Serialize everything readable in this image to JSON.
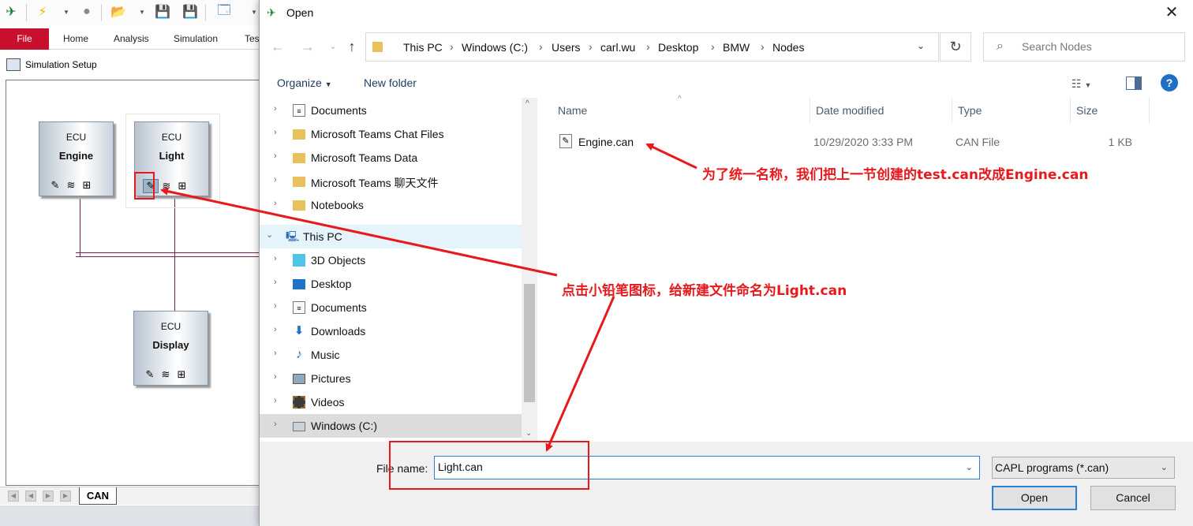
{
  "app": {
    "ribbon_tabs": [
      "File",
      "Home",
      "Analysis",
      "Simulation",
      "Tes"
    ],
    "toolbar_label": "Simulation Setup",
    "ecus": [
      {
        "kind": "ECU",
        "name": "Engine"
      },
      {
        "kind": "ECU",
        "name": "Light"
      },
      {
        "kind": "ECU",
        "name": "Display"
      }
    ],
    "bus_tab": "CAN",
    "accent_color": "#c8102e",
    "wire_color": "#7d1f4e"
  },
  "dialog": {
    "title": "Open",
    "breadcrumbs": [
      "This PC",
      "Windows (C:)",
      "Users",
      "carl.wu",
      "Desktop",
      "BMW",
      "Nodes"
    ],
    "search_placeholder": "Search Nodes",
    "organize_label": "Organize",
    "new_folder_label": "New folder",
    "tree": [
      {
        "label": "Documents",
        "icon": "document-icon"
      },
      {
        "label": "Microsoft Teams Chat Files",
        "icon": "folder-icon"
      },
      {
        "label": "Microsoft Teams Data",
        "icon": "folder-icon"
      },
      {
        "label": "Microsoft Teams 聊天文件",
        "icon": "folder-icon"
      },
      {
        "label": "Notebooks",
        "icon": "folder-icon"
      },
      {
        "label": "This PC",
        "icon": "computer-icon"
      },
      {
        "label": "3D Objects",
        "icon": "cube-icon"
      },
      {
        "label": "Desktop",
        "icon": "desktop-icon"
      },
      {
        "label": "Documents",
        "icon": "document-icon"
      },
      {
        "label": "Downloads",
        "icon": "download-icon"
      },
      {
        "label": "Music",
        "icon": "music-icon"
      },
      {
        "label": "Pictures",
        "icon": "picture-icon"
      },
      {
        "label": "Videos",
        "icon": "video-icon"
      },
      {
        "label": "Windows (C:)",
        "icon": "drive-icon"
      }
    ],
    "columns": [
      "Name",
      "Date modified",
      "Type",
      "Size"
    ],
    "files": [
      {
        "name": "Engine.can",
        "date": "10/29/2020 3:33 PM",
        "type": "CAN File",
        "size": "1 KB"
      }
    ],
    "file_name_label": "File name:",
    "file_name_value": "Light.can",
    "file_type": "CAPL programs (*.can)",
    "open_label": "Open",
    "cancel_label": "Cancel"
  },
  "annotations": {
    "rename_note": "为了统一名称，我们把上一节创建的test.can改成Engine.can",
    "pencil_note": "点击小铅笔图标，给新建文件命名为Light.can",
    "color": "#e8191c"
  }
}
